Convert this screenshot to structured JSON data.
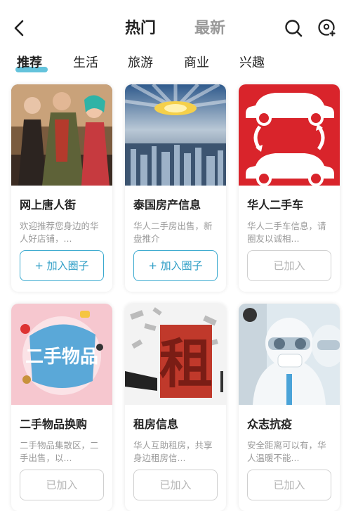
{
  "header": {
    "tab_hot": "热门",
    "tab_new": "最新",
    "search_icon": "search-icon",
    "add_icon": "add-circle-icon"
  },
  "categories": [
    "推荐",
    "生活",
    "旅游",
    "商业",
    "兴趣"
  ],
  "colors": {
    "accent": "#49b8d6",
    "join_border": "#3aa9cf",
    "joined_border": "#d0d0d0",
    "muted": "#9a9a9a"
  },
  "cards": [
    {
      "title": "网上唐人街",
      "desc": "欢迎推荐您身边的华人好店铺，...",
      "button": "+ 加入圈子"
    },
    {
      "title": "泰国房产信息",
      "desc": "华人二手房出售，新盘推介",
      "button": "+ 加入圈子"
    },
    {
      "title": "华人二手车",
      "desc": "华人二手车信息，请圈友以诚相...",
      "button": "已加入"
    },
    {
      "title": "二手物品换购",
      "desc": "二手物品集散区，二手出售，以...",
      "button": "已加入"
    },
    {
      "title": "租房信息",
      "desc": "华人互助租房，共享身边租房信...",
      "button": "已加入"
    },
    {
      "title": "众志抗疫",
      "desc": "安全距离可以有，华人温暖不能...",
      "button": "已加入"
    }
  ],
  "thumb_text": {
    "secondhand_sign": "二手物品",
    "rent_char": "租"
  }
}
